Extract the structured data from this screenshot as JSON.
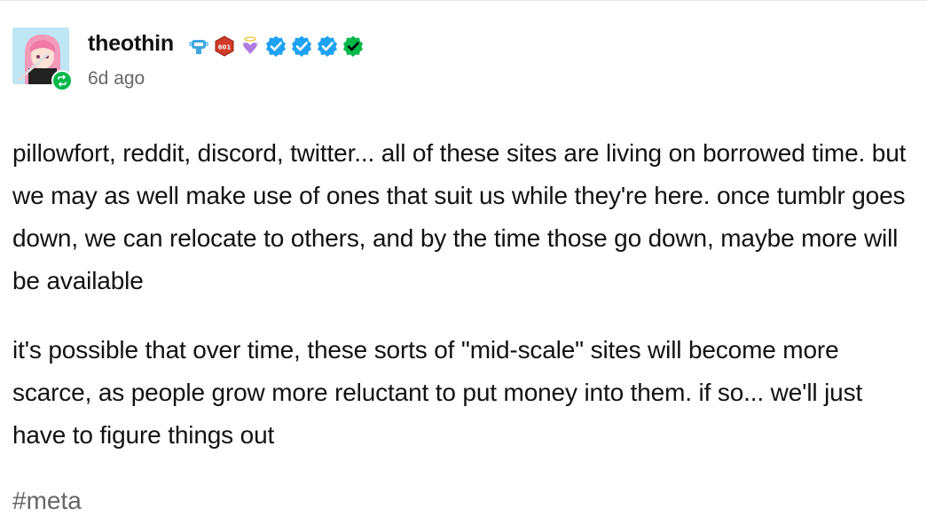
{
  "post": {
    "username": "theothin",
    "timestamp": "6d ago",
    "paragraphs": [
      "pillowfort, reddit, discord, twitter... all of these sites are living on borrowed time. but we may as well make use of ones that suit us while they're here. once tumblr goes down, we can relocate to others, and by the time those go down, maybe more will be available",
      "it's possible that over time, these sorts of \"mid-scale\" sites will become more scarce, as people grow more reluctant to put money into them. if so... we'll just have to figure things out"
    ],
    "tags": [
      "#meta"
    ]
  },
  "badges": [
    {
      "name": "robot-badge-icon"
    },
    {
      "name": "red-hex-badge-icon",
      "label": "601"
    },
    {
      "name": "heart-angel-badge-icon"
    },
    {
      "name": "verified-blue-check-icon"
    },
    {
      "name": "verified-blue-check-icon"
    },
    {
      "name": "verified-blue-check-icon"
    },
    {
      "name": "verified-green-check-icon"
    }
  ],
  "colors": {
    "username": "#121212",
    "secondary_text": "#666666",
    "reblog_green": "#00b84a",
    "verified_blue": "#1da1f2",
    "verified_green": "#00b84a"
  }
}
